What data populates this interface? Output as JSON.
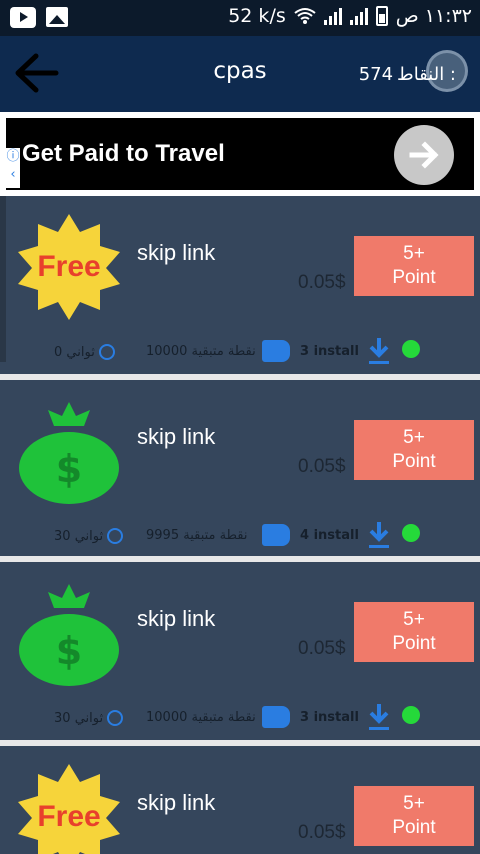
{
  "status_bar": {
    "time": "١١:٣٢ ص",
    "network_speed": "52 k/s",
    "icons": [
      "youtube-icon",
      "gallery-icon",
      "wifi-icon",
      "signal-icon",
      "battery-icon"
    ]
  },
  "toolbar": {
    "title": "cpas",
    "points_label": "النقاط :",
    "points_value": "574",
    "back_icon": "arrow-left-icon"
  },
  "ad": {
    "title": "Get Paid to Travel",
    "cta_icon": "arrow-right-icon",
    "info_icon": "info-icon"
  },
  "offers": [
    {
      "title": "skip link",
      "price": "0.05$",
      "button": "5+\nPoint",
      "icon": "free-badge",
      "install": "3 install",
      "remaining": "10000 نقطة متبقية",
      "time": "0 ثواني"
    },
    {
      "title": "skip link",
      "price": "0.05$",
      "button": "5+\nPoint",
      "icon": "money-bag",
      "install": "4 install",
      "remaining": "9995 نقطة متبقية",
      "time": "30 ثواني"
    },
    {
      "title": "skip link",
      "price": "0.05$",
      "button": "5+\nPoint",
      "icon": "money-bag",
      "install": "3 install",
      "remaining": "10000 نقطة متبقية",
      "time": "30 ثواني"
    },
    {
      "title": "skip link",
      "price": "0.05$",
      "button": "5+\nPoint",
      "icon": "free-badge"
    }
  ],
  "colors": {
    "toolbar": "#0e2a4f",
    "card": "#35465c",
    "button": "#f07a6a",
    "accent_blue": "#2a7de1",
    "status_green": "#25d93a",
    "money_green": "#1fc23a",
    "free_yellow": "#f6d43a"
  },
  "free_label": "Free",
  "dollar_sign": "$"
}
